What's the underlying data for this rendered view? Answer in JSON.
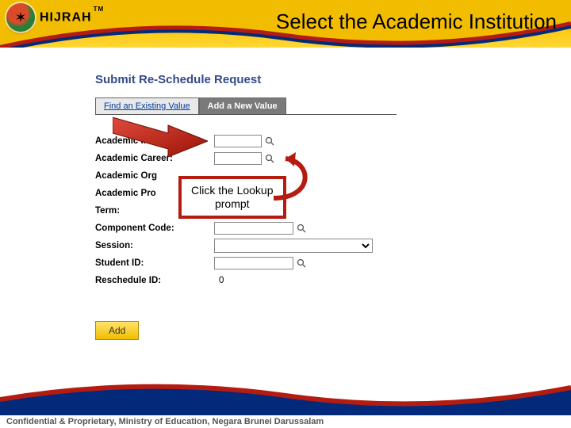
{
  "brand": {
    "name": "HIJRAH",
    "tm": "TM"
  },
  "slide_title": "Select the Academic Institution",
  "page": {
    "heading": "Submit Re-Schedule Request",
    "tabs": {
      "find": "Find an Existing Value",
      "add": "Add a New Value"
    },
    "fields": {
      "institution": {
        "label": "Academic Institution:"
      },
      "career": {
        "label": "Academic Career:"
      },
      "org": {
        "label": "Academic Org"
      },
      "program": {
        "label": "Academic Pro"
      },
      "term": {
        "label": "Term:"
      },
      "component": {
        "label": "Component Code:"
      },
      "session": {
        "label": "Session:"
      },
      "student": {
        "label": "Student ID:"
      },
      "resched": {
        "label": "Reschedule ID:",
        "value": "0"
      }
    },
    "add_button": "Add"
  },
  "annotation": {
    "bubble_line1": "Click the Lookup",
    "bubble_line2": "prompt"
  },
  "footer": "Confidential & Proprietary, Ministry of Education, Negara Brunei Darussalam"
}
